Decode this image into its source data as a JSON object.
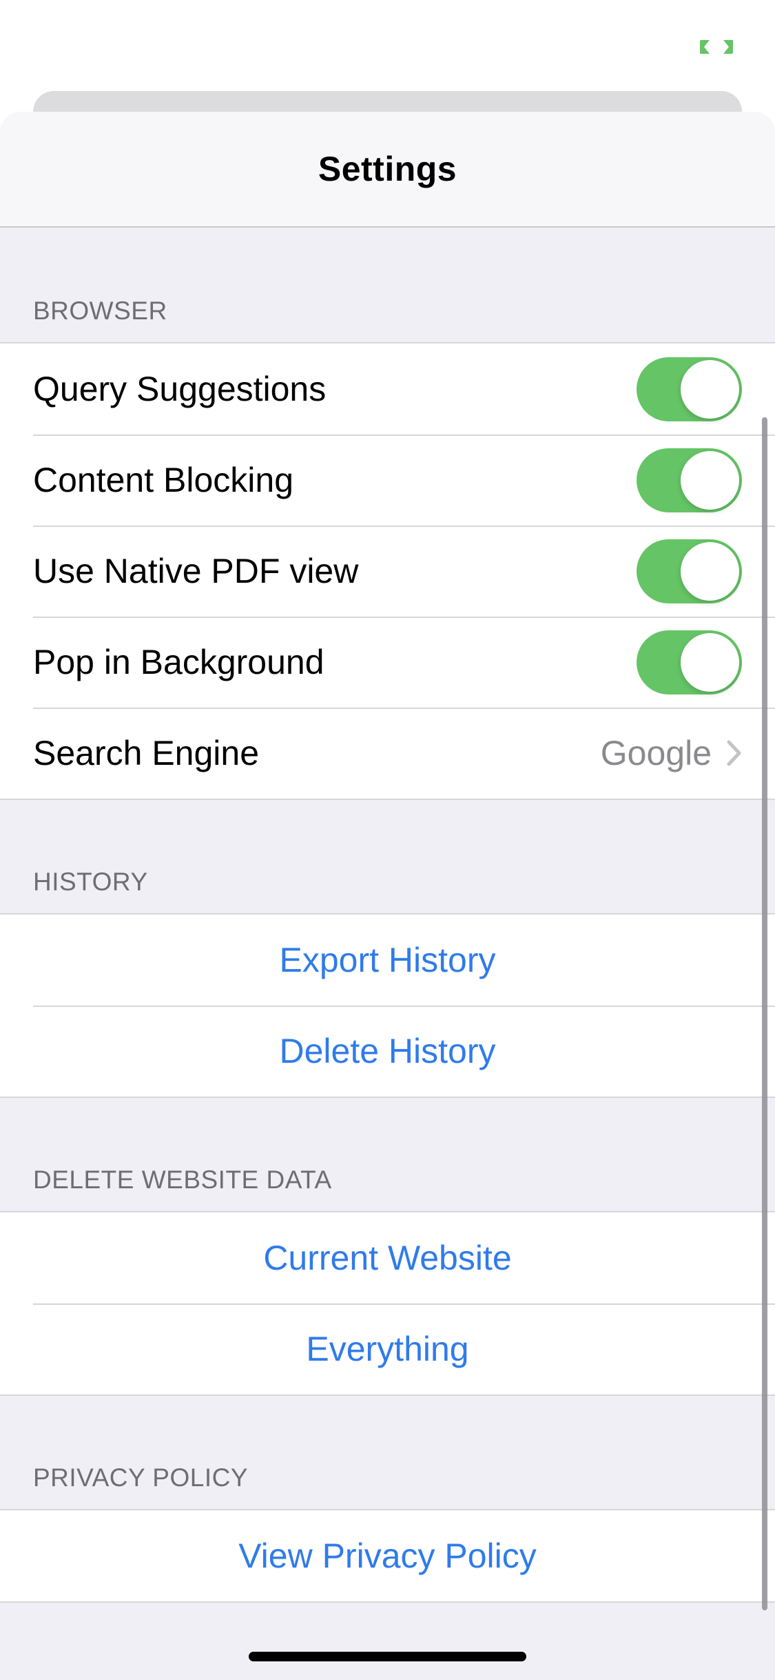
{
  "accent_color": "#65c466",
  "link_color": "#2f7bea",
  "status_bar": {
    "icon": "fullscreen-corners-icon"
  },
  "nav": {
    "title": "Settings"
  },
  "browser": {
    "header": "BROWSER",
    "rows": [
      {
        "label": "Query Suggestions",
        "toggle": true
      },
      {
        "label": "Content Blocking",
        "toggle": true
      },
      {
        "label": "Use Native PDF view",
        "toggle": true
      },
      {
        "label": "Pop in Background",
        "toggle": true
      },
      {
        "label": "Search Engine",
        "value": "Google"
      }
    ]
  },
  "history": {
    "header": "HISTORY",
    "actions": [
      "Export History",
      "Delete History"
    ]
  },
  "website_data": {
    "header": "DELETE WEBSITE DATA",
    "actions": [
      "Current Website",
      "Everything"
    ]
  },
  "privacy": {
    "header": "PRIVACY POLICY",
    "actions": [
      "View Privacy Policy"
    ]
  }
}
